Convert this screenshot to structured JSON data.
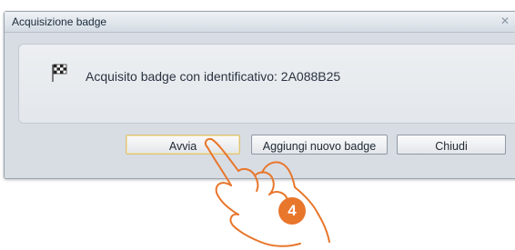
{
  "dialog": {
    "title": "Acquisizione badge",
    "close_glyph": "✕",
    "message": "Acquisito badge con identificativo: 2A088B25",
    "icon": "checkered-flag-icon"
  },
  "buttons": {
    "start_label": "Avvia",
    "add_label": "Aggiungi nuovo badge",
    "close_label": "Chiudi"
  },
  "annotation": {
    "step_number": "4",
    "pointer_icon": "hand-pointer-icon"
  },
  "colors": {
    "step_badge": "#e8762b",
    "hand_outline": "#e8762b"
  }
}
